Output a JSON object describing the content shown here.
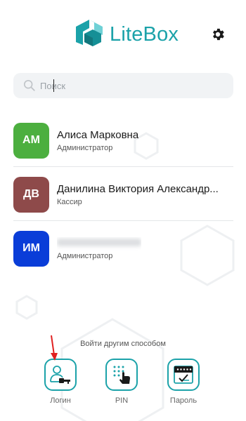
{
  "header": {
    "brand": "LiteBox",
    "settings_icon": "gear-icon",
    "brand_color": "#1ba2a9"
  },
  "search": {
    "placeholder": "Поиск",
    "value": "",
    "icon": "search-icon"
  },
  "users": [
    {
      "initials": "АМ",
      "name": "Алиса Марковна",
      "role": "Администратор",
      "color": "#4caf3f"
    },
    {
      "initials": "ДВ",
      "name": "Данилина Виктория Александр...",
      "role": "Кассир",
      "color": "#8e4a4a"
    },
    {
      "initials": "ИМ",
      "name": "",
      "role": "Администратор",
      "color": "#0a3dd8"
    }
  ],
  "alt_login": {
    "label": "Войти другим способом",
    "methods": [
      {
        "label": "Логин",
        "icon": "user-key-icon"
      },
      {
        "label": "PIN",
        "icon": "pin-keypad-icon"
      },
      {
        "label": "Пароль",
        "icon": "password-icon"
      }
    ]
  },
  "annotation": {
    "arrow_color": "#e02020"
  }
}
